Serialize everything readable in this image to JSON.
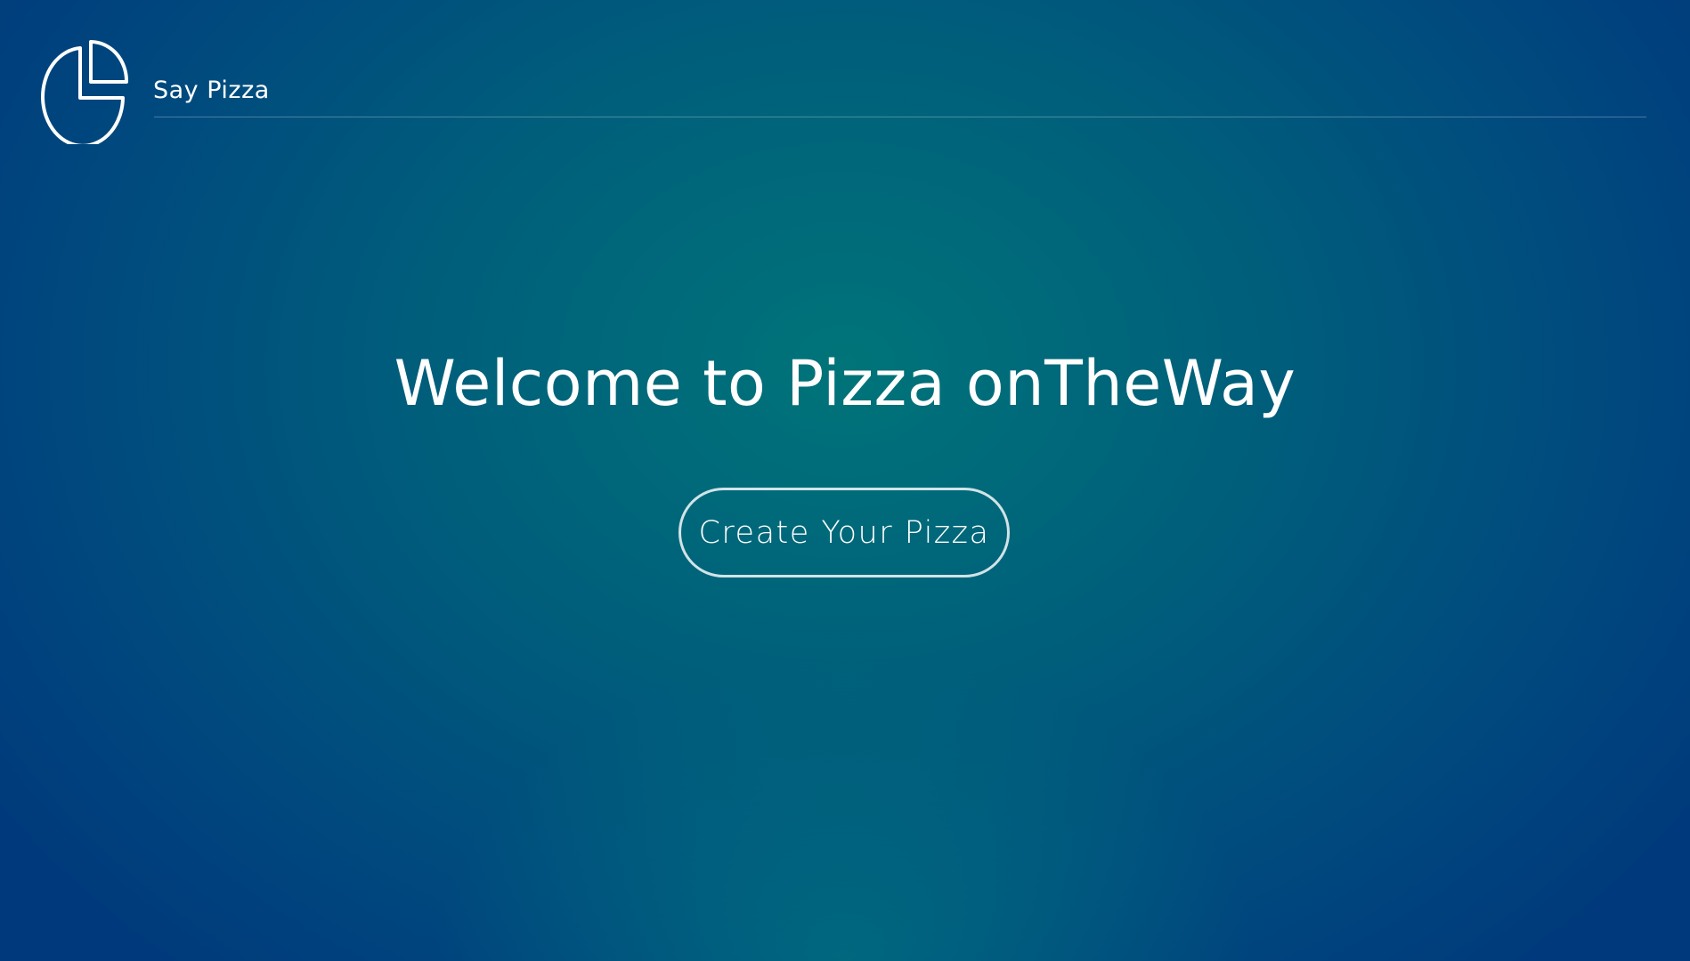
{
  "header": {
    "brand_name": "Say Pizza",
    "logo_icon": "pie-chart-icon"
  },
  "hero": {
    "title": "Welcome to Pizza onTheWay",
    "cta_label": "Create Your Pizza"
  },
  "colors": {
    "background_center": "#007479",
    "background_edge": "#003a7c",
    "foreground": "#ffffff"
  }
}
